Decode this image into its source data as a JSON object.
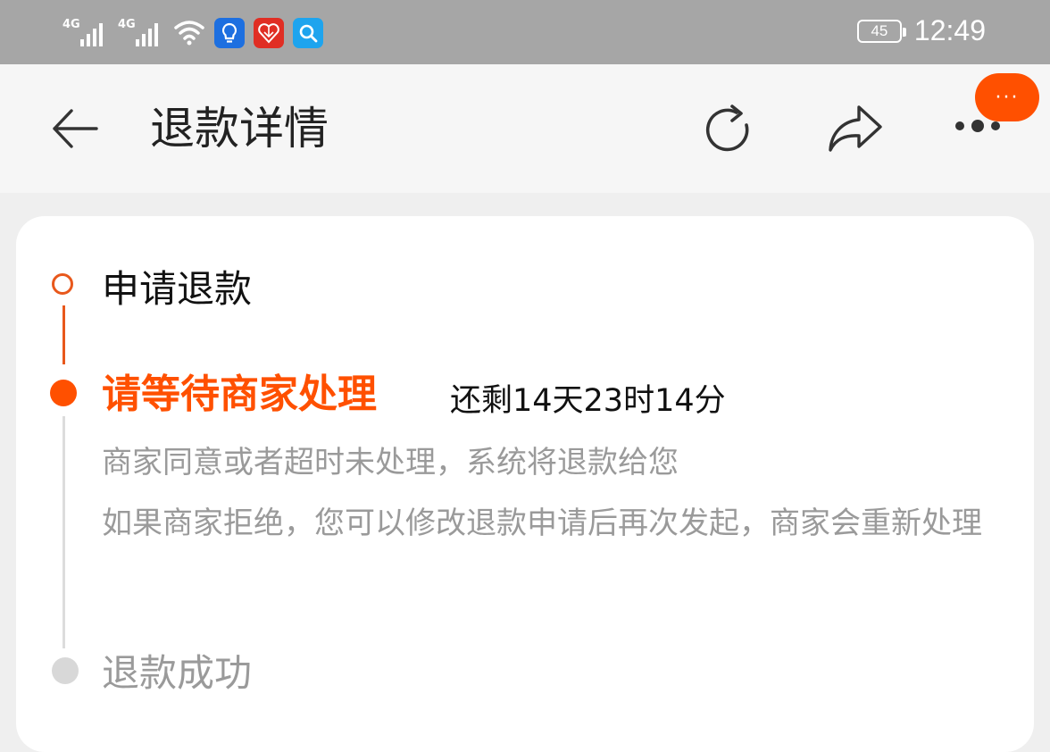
{
  "status_bar": {
    "signal1_label": "4G",
    "signal2_label": "4G",
    "battery_level": "45",
    "time": "12:49",
    "apps": [
      "lightbulb-app-icon",
      "pinduoduo-app-icon",
      "search-app-icon"
    ]
  },
  "header": {
    "title": "退款详情",
    "bubble_text": "···"
  },
  "timeline": {
    "step1": "申请退款",
    "step2": "请等待商家处理",
    "countdown": "还剩14天23时14分",
    "desc1": "商家同意或者超时未处理，系统将退款给您",
    "desc2": "如果商家拒绝，您可以修改退款申请后再次发起，商家会重新处理",
    "step3": "退款成功"
  },
  "colors": {
    "accent": "#ff5000",
    "status_bar_bg": "#a6a6a6",
    "muted_text": "#9a9a9a",
    "inactive_dot": "#d8d8d8"
  }
}
